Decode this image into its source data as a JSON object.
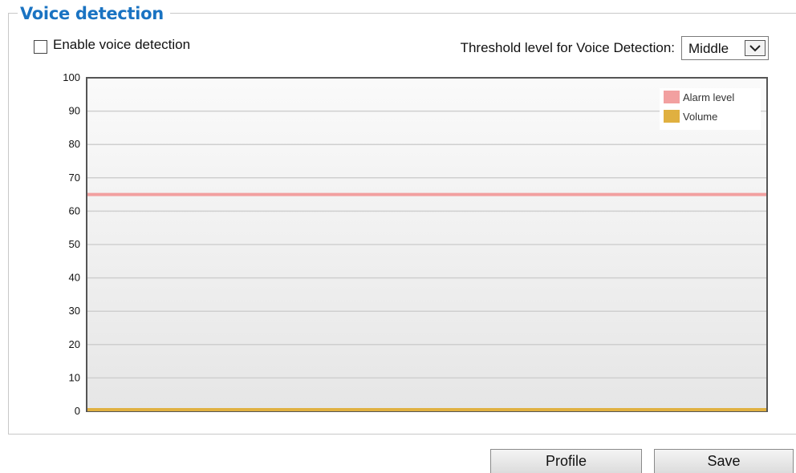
{
  "section": {
    "title": "Voice detection"
  },
  "enable": {
    "label": "Enable voice detection",
    "checked": false
  },
  "threshold": {
    "label": "Threshold level for Voice Detection:",
    "value": "Middle"
  },
  "chart_data": {
    "type": "line",
    "ylim": [
      0,
      100
    ],
    "y_ticks": [
      0,
      10,
      20,
      30,
      40,
      50,
      60,
      70,
      80,
      90,
      100
    ],
    "grid": true,
    "legend_position": "top-right",
    "series": [
      {
        "name": "Alarm level",
        "color": "#f2a0a0",
        "value": 65
      },
      {
        "name": "Volume",
        "color": "#e0b040",
        "value": 0
      }
    ]
  },
  "buttons": {
    "profile": "Profile",
    "save": "Save"
  }
}
